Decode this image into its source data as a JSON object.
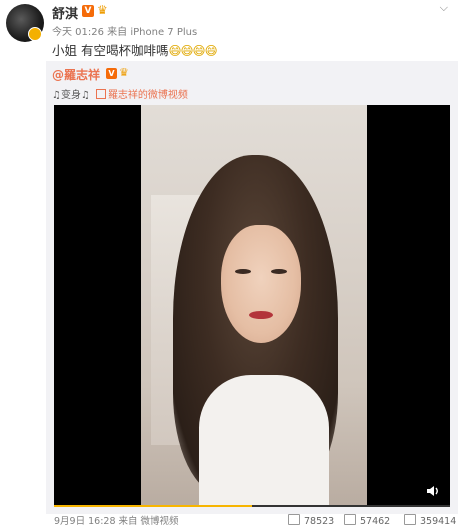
{
  "post": {
    "author": "舒淇",
    "verified_badge": "V",
    "meta": "今天 01:26 来自 iPhone 7 Plus",
    "text": "小姐 有空喝杯咖啡嗎",
    "emojis": "😄😄😄😄"
  },
  "repost": {
    "author": "@羅志祥",
    "verified_badge": "V",
    "text_prefix": "♫变身♫",
    "link_text": "羅志祥的微博视频"
  },
  "video": {
    "progress_fraction": 0.5
  },
  "footer": {
    "left": "9月9日 16:28 来自 微博视频",
    "reposts": "78523",
    "comments": "57462",
    "likes": "359414"
  },
  "colors": {
    "link": "#eb7350",
    "badge": "#f56b09",
    "progress": "#f7b500"
  }
}
